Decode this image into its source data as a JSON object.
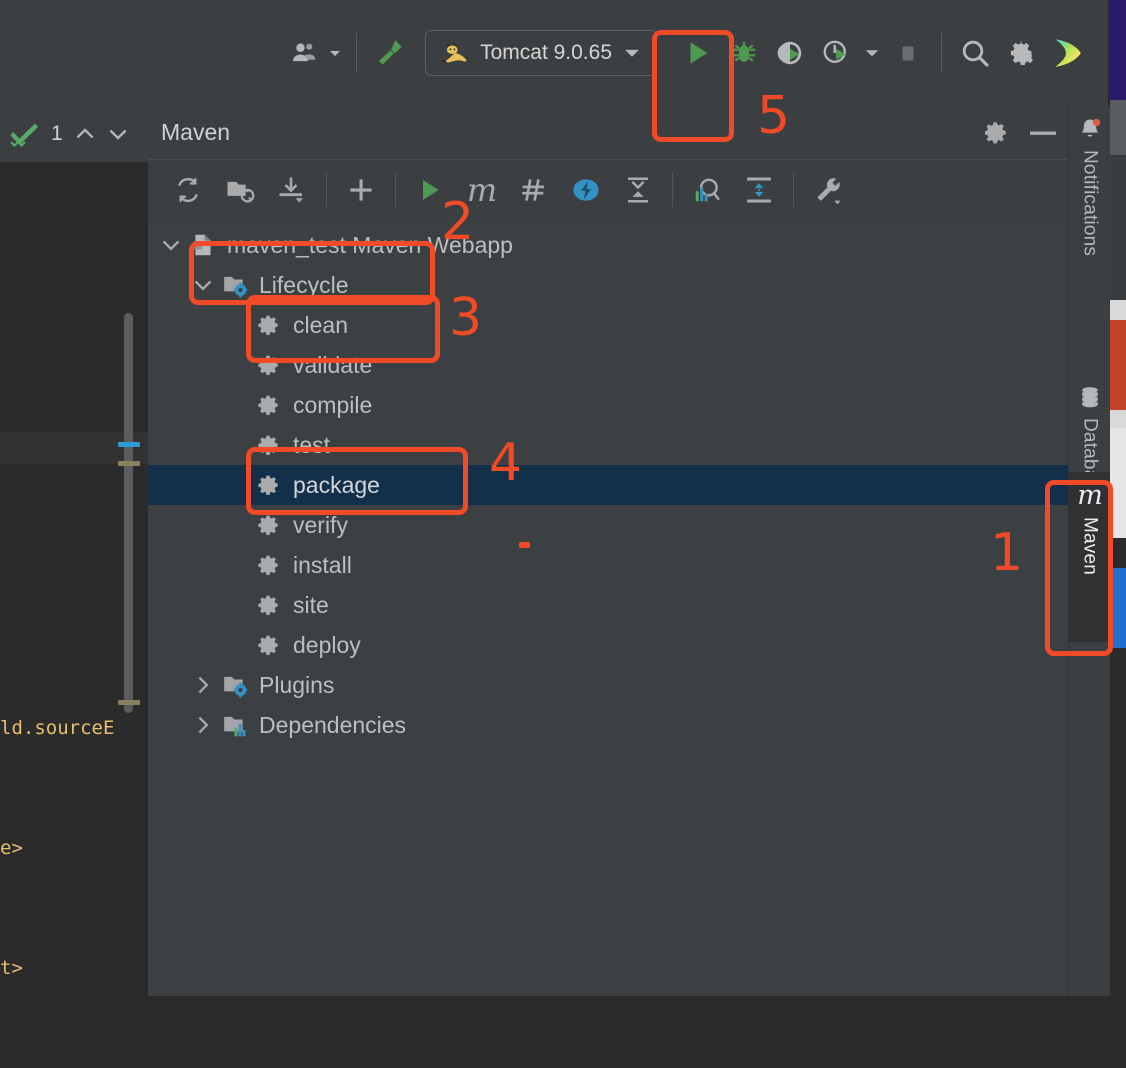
{
  "app": {
    "title": "IntelliJ IDEA - Maven tool window",
    "accent_red": "#f04a26",
    "panel_bg": "#3c4043",
    "toolbar_bg": "#3c3f41",
    "editor_bg": "#2b2b2b",
    "selection_bg": "#123049",
    "green": "#4e9a51",
    "blue_gear": "#3592c4"
  },
  "top_toolbar": {
    "avatar_icon": "user-account-icon",
    "avatar_dropdown_icon": "chevron-down-icon",
    "build_icon": "build-hammer-icon",
    "run_config": {
      "icon": "tomcat-cat-icon",
      "label": "Tomcat 9.0.65",
      "dropdown_icon": "chevron-down-icon"
    },
    "run_icon": "run-play-icon",
    "debug_icon": "debug-bug-icon",
    "run_with_coverage_icon": "run-coverage-icon",
    "profiler_icon": "profiler-clock-icon",
    "profiler_dropdown_icon": "chevron-down-icon",
    "stop_icon": "stop-square-icon",
    "search_icon": "search-magnifier-icon",
    "settings_icon": "gear-icon",
    "ide_assistant_icon": "ide-assistant-icon"
  },
  "editor": {
    "inspections": {
      "status_icon": "inspection-ok-icon",
      "count": "1",
      "prev_icon": "chevron-up-icon",
      "next_icon": "chevron-down-icon"
    },
    "kebab_icon": "more-vertical-icon",
    "code_lines": [
      "ld.sourceE",
      "e>",
      "t>"
    ]
  },
  "maven_panel": {
    "title": "Maven",
    "header_actions": [
      {
        "name": "settings-gear-icon",
        "label": ""
      },
      {
        "name": "minimize-icon",
        "label": ""
      }
    ],
    "toolbar": [
      {
        "name": "reload-all-maven-projects-icon",
        "label": "Reload All Maven Projects"
      },
      {
        "name": "generate-sources-folders-icon",
        "label": "Generate Sources and Update Folders"
      },
      {
        "name": "download-sources-icon",
        "label": "Download Sources and/or Documentation"
      },
      {
        "name": "add-maven-project-icon",
        "label": "Add Maven Project"
      },
      {
        "name": "run-maven-build-icon",
        "label": "Run Maven Build"
      },
      {
        "name": "execute-maven-goal-icon",
        "label": "Execute Maven Goal"
      },
      {
        "name": "toggle-skip-tests-icon",
        "label": "Toggle 'Skip Tests' Mode"
      },
      {
        "name": "toggle-offline-mode-icon",
        "label": "Toggle Offline Mode"
      },
      {
        "name": "collapse-all-icon",
        "label": "Collapse All"
      },
      {
        "name": "show-dependencies-analyzer-icon",
        "label": "Analyze Dependencies"
      },
      {
        "name": "expand-icon",
        "label": "Expand"
      },
      {
        "name": "maven-settings-wrench-icon",
        "label": "Maven Settings"
      }
    ],
    "tree": [
      {
        "label": "maven_test Maven Webapp",
        "depth": 0,
        "twisty": "chevron-down-icon",
        "icon": "maven-module-icon",
        "selected": false
      },
      {
        "label": "Lifecycle",
        "depth": 1,
        "twisty": "chevron-down-icon",
        "icon": "lifecycle-folder-icon",
        "selected": false
      },
      {
        "label": "clean",
        "depth": 2,
        "twisty": "",
        "icon": "goal-gear-icon",
        "selected": false
      },
      {
        "label": "validate",
        "depth": 2,
        "twisty": "",
        "icon": "goal-gear-icon",
        "selected": false
      },
      {
        "label": "compile",
        "depth": 2,
        "twisty": "",
        "icon": "goal-gear-icon",
        "selected": false
      },
      {
        "label": "test",
        "depth": 2,
        "twisty": "",
        "icon": "goal-gear-icon",
        "selected": false
      },
      {
        "label": "package",
        "depth": 2,
        "twisty": "",
        "icon": "goal-gear-icon",
        "selected": true
      },
      {
        "label": "verify",
        "depth": 2,
        "twisty": "",
        "icon": "goal-gear-icon",
        "selected": false
      },
      {
        "label": "install",
        "depth": 2,
        "twisty": "",
        "icon": "goal-gear-icon",
        "selected": false
      },
      {
        "label": "site",
        "depth": 2,
        "twisty": "",
        "icon": "goal-gear-icon",
        "selected": false
      },
      {
        "label": "deploy",
        "depth": 2,
        "twisty": "",
        "icon": "goal-gear-icon",
        "selected": false
      },
      {
        "label": "Plugins",
        "depth": 1,
        "twisty": "chevron-right-icon",
        "icon": "plugins-folder-icon",
        "selected": false
      },
      {
        "label": "Dependencies",
        "depth": 1,
        "twisty": "chevron-right-icon",
        "icon": "dependencies-folder-icon",
        "selected": false
      }
    ]
  },
  "right_tool_strip": [
    {
      "label": "Notifications",
      "icon": "bell-icon",
      "badge": true,
      "active": false
    },
    {
      "label": "Database",
      "icon": "database-icon",
      "badge": false,
      "active": false
    },
    {
      "label": "Maven",
      "icon": "maven-m-icon",
      "badge": false,
      "active": true
    }
  ],
  "annotations": [
    {
      "number": "1",
      "target": "maven-tool-window-tab"
    },
    {
      "number": "2",
      "target": "lifecycle-tree-node"
    },
    {
      "number": "3",
      "target": "clean-goal"
    },
    {
      "number": "4",
      "target": "package-goal"
    },
    {
      "number": "5",
      "target": "run-button"
    }
  ]
}
